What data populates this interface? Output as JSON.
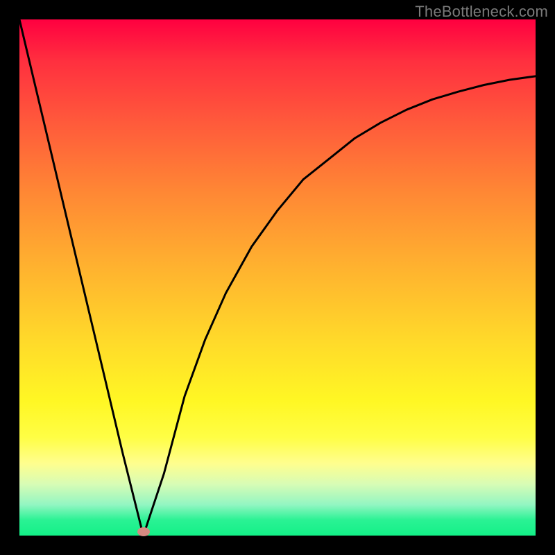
{
  "watermark": "TheBottleneck.com",
  "chart_data": {
    "type": "line",
    "title": "",
    "xlabel": "",
    "ylabel": "",
    "xlim": [
      0,
      100
    ],
    "ylim": [
      0,
      100
    ],
    "grid": false,
    "series": [
      {
        "name": "bottleneck-curve",
        "x": [
          0,
          5,
          10,
          15,
          20,
          24,
          28,
          32,
          36,
          40,
          45,
          50,
          55,
          60,
          65,
          70,
          75,
          80,
          85,
          90,
          95,
          100
        ],
        "y": [
          100,
          79,
          58,
          37,
          16,
          0,
          12,
          27,
          38,
          47,
          56,
          63,
          69,
          73,
          77,
          80,
          82.5,
          84.5,
          86,
          87.3,
          88.3,
          89
        ]
      }
    ],
    "marker": {
      "name": "minimum-point",
      "x": 24,
      "y": 0,
      "color": "#d68a82"
    },
    "background_gradient": {
      "orientation": "vertical",
      "stops": [
        {
          "pos": 0.0,
          "color": "#ff0040"
        },
        {
          "pos": 0.5,
          "color": "#ffb22f"
        },
        {
          "pos": 0.78,
          "color": "#fffe45"
        },
        {
          "pos": 1.0,
          "color": "#13f087"
        }
      ]
    }
  }
}
